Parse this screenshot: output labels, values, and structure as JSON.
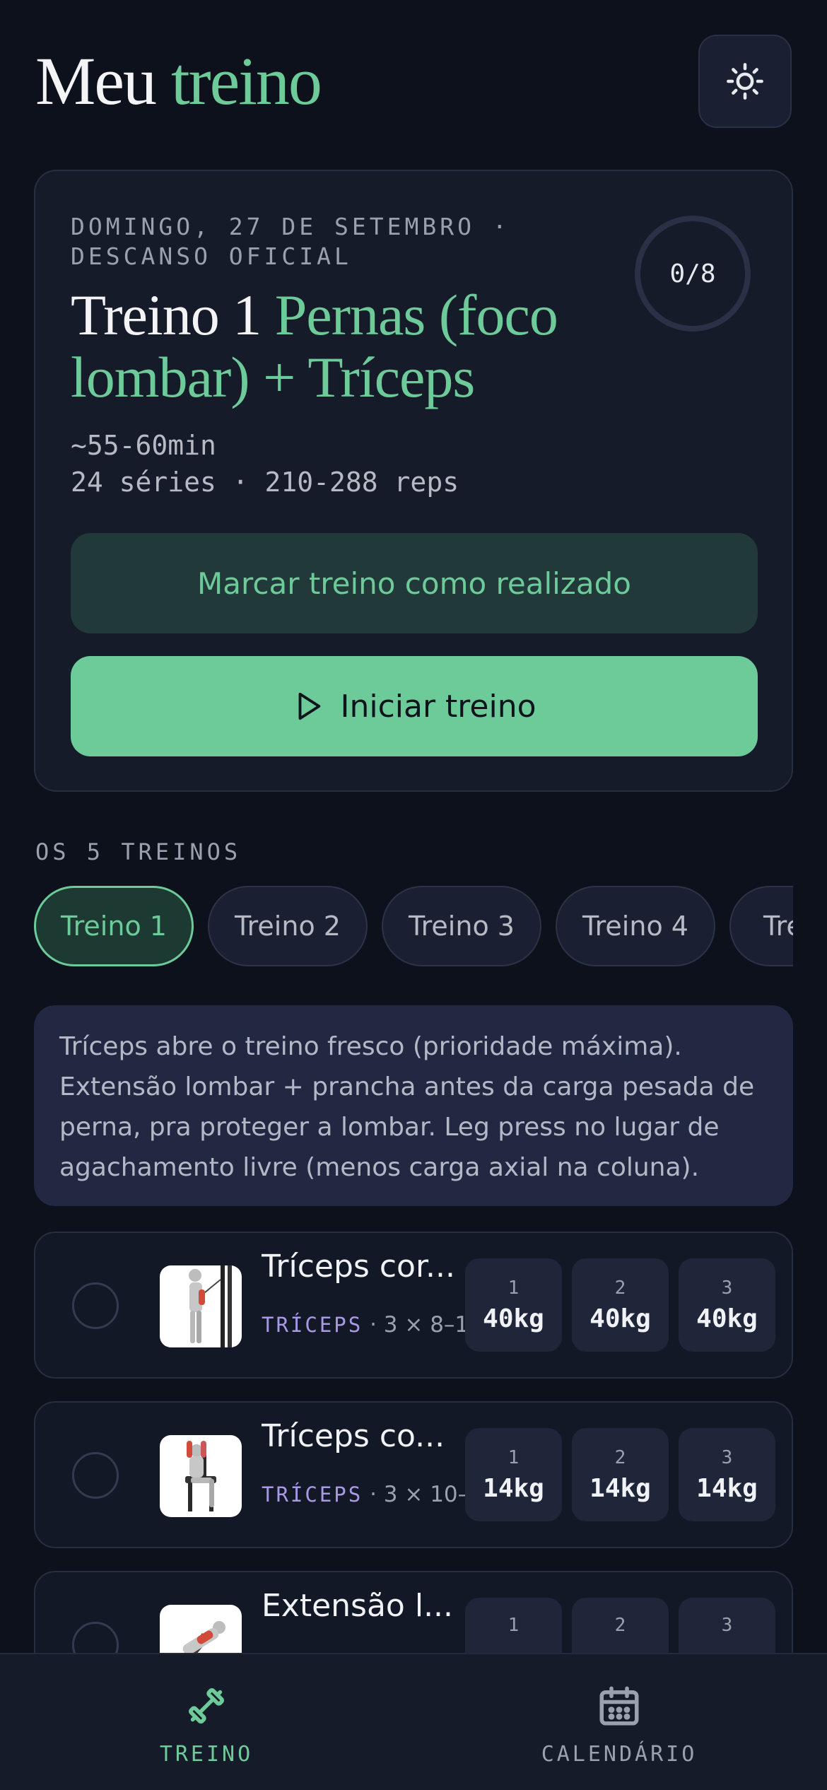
{
  "header": {
    "title_part1": "Meu",
    "title_part2": "treino",
    "theme_toggle_icon": "sun-icon"
  },
  "today": {
    "date_line": "DOMINGO, 27 DE SETEMBRO · DESCANSO OFICIAL",
    "progress": "0/8",
    "progress_done": 0,
    "progress_total": 8,
    "title_prefix": "Treino 1",
    "title_rest": "Pernas (foco lombar) + Tríceps",
    "duration": "~55-60min",
    "volume": "24 séries · 210-288 reps",
    "mark_done_label": "Marcar treino como realizado",
    "start_label": "Iniciar treino",
    "start_icon": "play-icon"
  },
  "workouts": {
    "section_label": "OS 5 TREINOS",
    "tabs": [
      {
        "label": "Treino 1",
        "active": true
      },
      {
        "label": "Treino 2",
        "active": false
      },
      {
        "label": "Treino 3",
        "active": false
      },
      {
        "label": "Treino 4",
        "active": false
      },
      {
        "label": "Tre",
        "active": false
      }
    ]
  },
  "note": "Tríceps abre o treino fresco (prioridade máxima). Extensão lombar + prancha antes da carga pesada de perna, pra proteger a lombar. Leg press no lugar de agachamento livre (menos carga axial na coluna).",
  "exercises": [
    {
      "name": "Tríceps cor...",
      "tag": "TRÍCEPS",
      "scheme": "· 3 × 8–1",
      "sets": [
        {
          "n": "1",
          "w": "40kg"
        },
        {
          "n": "2",
          "w": "40kg"
        },
        {
          "n": "3",
          "w": "40kg"
        }
      ]
    },
    {
      "name": "Tríceps co...",
      "tag": "TRÍCEPS",
      "scheme": "· 3 × 10–",
      "sets": [
        {
          "n": "1",
          "w": "14kg"
        },
        {
          "n": "2",
          "w": "14kg"
        },
        {
          "n": "3",
          "w": "14kg"
        }
      ]
    },
    {
      "name": "Extensão l...",
      "tag": "",
      "scheme": "",
      "sets": [
        {
          "n": "1",
          "w": ""
        },
        {
          "n": "2",
          "w": ""
        },
        {
          "n": "3",
          "w": ""
        }
      ]
    }
  ],
  "nav": {
    "items": [
      {
        "label": "TREINO",
        "icon": "dumbbell-icon",
        "active": true
      },
      {
        "label": "CALENDÁRIO",
        "icon": "calendar-icon",
        "active": false
      }
    ]
  },
  "colors": {
    "accent": "#6dcb9a",
    "background": "#0c111b",
    "card": "#161b29",
    "muscle_tag": "#a998e6"
  }
}
